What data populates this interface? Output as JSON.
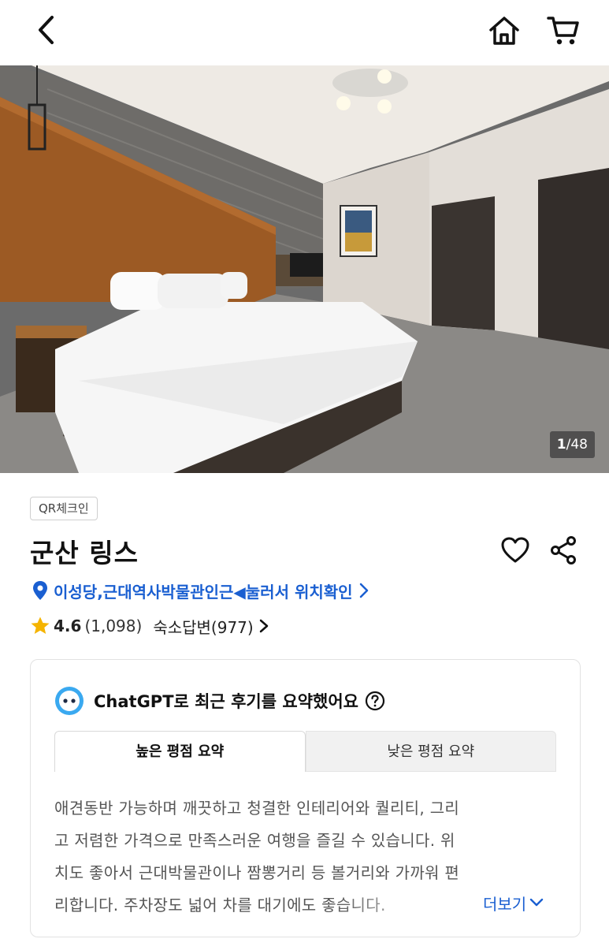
{
  "header": {
    "back_icon": "chevron-left-icon",
    "home_icon": "home-icon",
    "cart_icon": "cart-icon"
  },
  "gallery": {
    "current": "1",
    "total": "/48"
  },
  "property": {
    "badge": "QR체크인",
    "name": "군산 링스",
    "location": "이성당,근대역사박물관인근◀눌러서 위치확인",
    "rating": "4.6",
    "review_count": "(1,098)",
    "host_reply": "숙소답변(977)"
  },
  "summary_card": {
    "title": "ChatGPT로 최근 후기를 요약했어요",
    "tabs": [
      "높은 평점 요약",
      "낮은 평점 요약"
    ],
    "lines": [
      "애견동반 가능하며 깨끗하고 청결한 인테리어와 퀄리티, 그리",
      "고 저렴한 가격으로 만족스러운 여행을 즐길 수 있습니다. 위",
      "치도 좋아서 근대박물관이나 짬뽕거리 등 볼거리와 가까워 편",
      "리합니다. 주차장도 넓어 차를 대기에도 좋습니다."
    ],
    "more_label": "더보기"
  },
  "colors": {
    "link_blue": "#1a5fd1",
    "star_yellow": "#f5b400",
    "bot_blue": "#3aa9f0"
  }
}
